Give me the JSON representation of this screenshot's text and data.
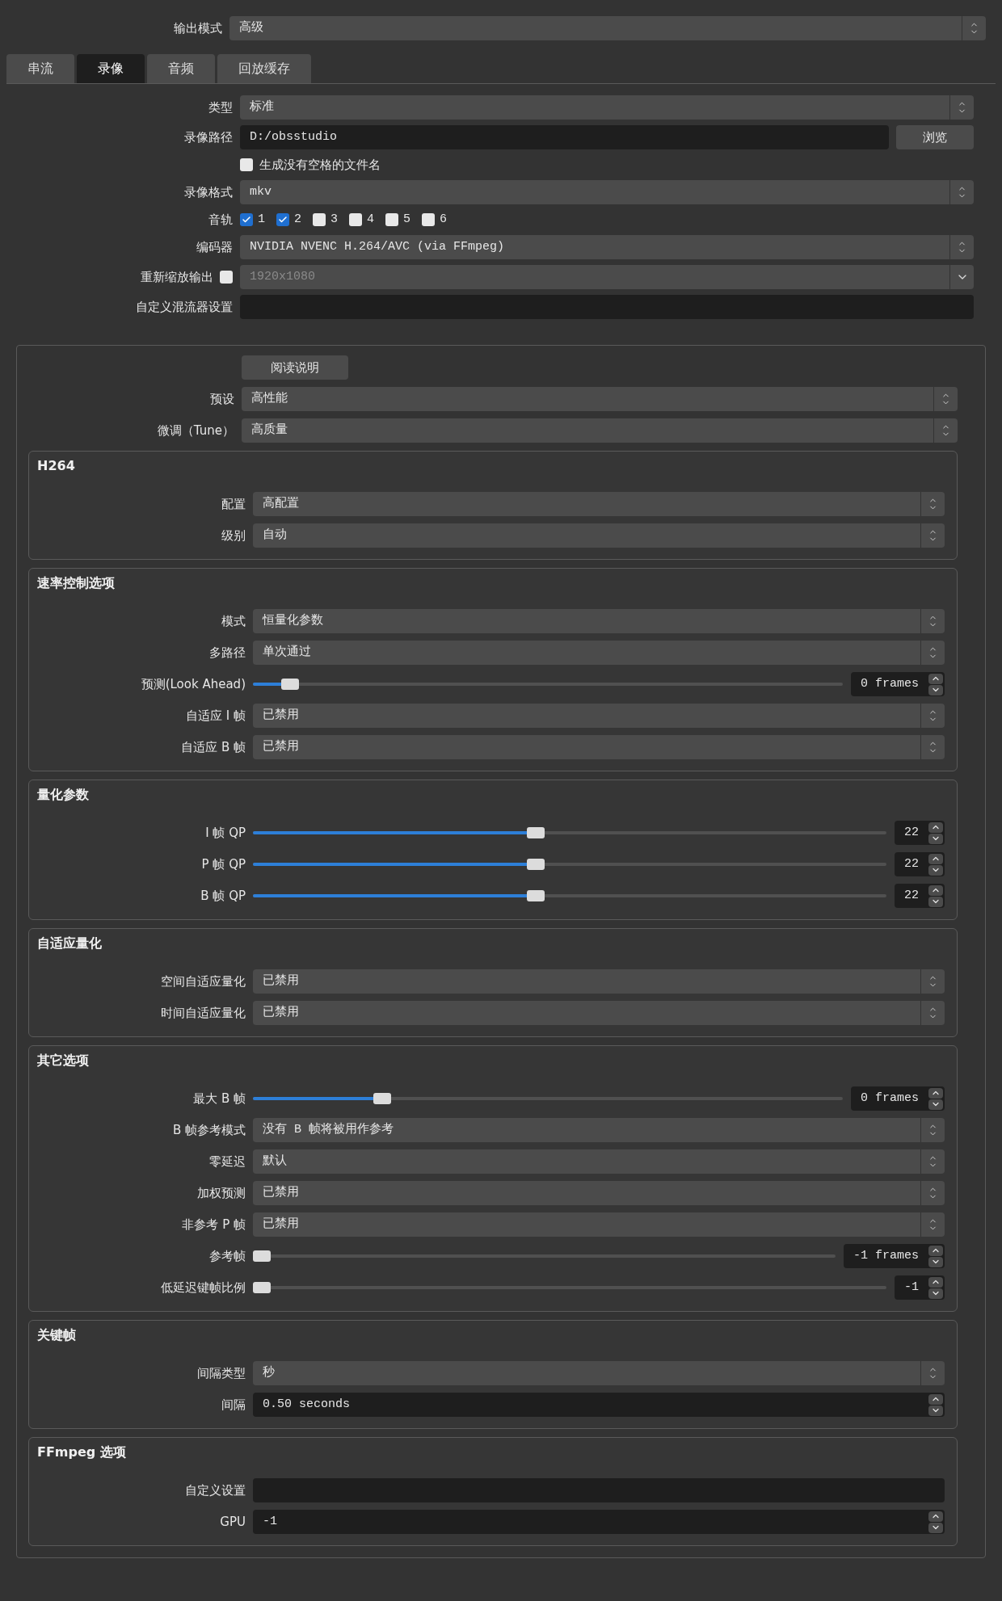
{
  "output_mode": {
    "label": "输出模式",
    "value": "高级"
  },
  "tabs": [
    {
      "label": "串流",
      "selected": false
    },
    {
      "label": "录像",
      "selected": true
    },
    {
      "label": "音频",
      "selected": false
    },
    {
      "label": "回放缓存",
      "selected": false
    }
  ],
  "recording": [
    {
      "kind": "combo",
      "label": "类型",
      "value": "标准"
    },
    {
      "kind": "path",
      "label": "录像路径",
      "value": "D:/obsstudio",
      "button": "浏览"
    },
    {
      "kind": "checkbox",
      "label": "生成没有空格的文件名",
      "checked": false
    },
    {
      "kind": "combo",
      "label": "录像格式",
      "value": "mkv"
    },
    {
      "kind": "tracks",
      "label": "音轨",
      "tracks": [
        {
          "label": "1",
          "checked": true
        },
        {
          "label": "2",
          "checked": true
        },
        {
          "label": "3",
          "checked": false
        },
        {
          "label": "4",
          "checked": false
        },
        {
          "label": "5",
          "checked": false
        },
        {
          "label": "6",
          "checked": false
        }
      ]
    },
    {
      "kind": "combo",
      "label": "编码器",
      "value": "NVIDIA NVENC H.264/AVC (via FFmpeg)"
    },
    {
      "kind": "scale",
      "label": "重新缩放输出",
      "checked": false,
      "value": "1920x1080",
      "disabled": true
    },
    {
      "kind": "input",
      "label": "自定义混流器设置"
    }
  ],
  "encoder": {
    "help_button": "阅读说明",
    "rows": [
      {
        "kind": "combo",
        "label": "预设",
        "value": "高性能"
      },
      {
        "kind": "combo",
        "label": "微调（Tune）",
        "value": "高质量"
      }
    ],
    "groups": [
      {
        "title": "H264",
        "rows": [
          {
            "kind": "combo",
            "label": "配置",
            "value": "高配置"
          },
          {
            "kind": "combo",
            "label": "级别",
            "value": "自动"
          }
        ]
      },
      {
        "title": "速率控制选项",
        "rows": [
          {
            "kind": "combo",
            "label": "模式",
            "value": "恒量化参数"
          },
          {
            "kind": "combo",
            "label": "多路径",
            "value": "单次通过"
          },
          {
            "kind": "slider",
            "label": "预测(Look Ahead)",
            "level": 0.05,
            "value": "0 frames"
          },
          {
            "kind": "combo",
            "label": "自适应 I 帧",
            "value": "已禁用"
          },
          {
            "kind": "combo",
            "label": "自适应 B 帧",
            "value": "已禁用"
          }
        ]
      },
      {
        "title": "量化参数",
        "rows": [
          {
            "kind": "slider",
            "label": "I 帧 QP",
            "level": 0.445,
            "value": "22"
          },
          {
            "kind": "slider",
            "label": "P 帧 QP",
            "level": 0.445,
            "value": "22"
          },
          {
            "kind": "slider",
            "label": "B 帧 QP",
            "level": 0.445,
            "value": "22"
          }
        ]
      },
      {
        "title": "自适应量化",
        "rows": [
          {
            "kind": "combo",
            "label": "空间自适应量化",
            "value": "已禁用"
          },
          {
            "kind": "combo",
            "label": "时间自适应量化",
            "value": "已禁用"
          }
        ]
      },
      {
        "title": "其它选项",
        "rows": [
          {
            "kind": "slider",
            "label": "最大 B 帧",
            "level": 0.21,
            "value": "0 frames"
          },
          {
            "kind": "combo",
            "label": "B 帧参考模式",
            "value": "没有 B 帧将被用作参考"
          },
          {
            "kind": "combo",
            "label": "零延迟",
            "value": "默认"
          },
          {
            "kind": "combo",
            "label": "加权预测",
            "value": "已禁用"
          },
          {
            "kind": "combo",
            "label": "非参考 P 帧",
            "value": "已禁用"
          },
          {
            "kind": "slider",
            "label": "参考帧",
            "level": 0,
            "value": "-1 frames"
          },
          {
            "kind": "slider",
            "label": "低延迟键帧比例",
            "level": 0,
            "value": "-1"
          }
        ]
      },
      {
        "title": "关键帧",
        "rows": [
          {
            "kind": "combo",
            "label": "间隔类型",
            "value": "秒"
          },
          {
            "kind": "spinfield",
            "label": "间隔",
            "value": "0.50 seconds"
          }
        ]
      },
      {
        "title": "FFmpeg 选项",
        "rows": [
          {
            "kind": "input",
            "label": "自定义设置"
          },
          {
            "kind": "spinfield",
            "label": "GPU",
            "value": "-1"
          }
        ]
      }
    ]
  }
}
